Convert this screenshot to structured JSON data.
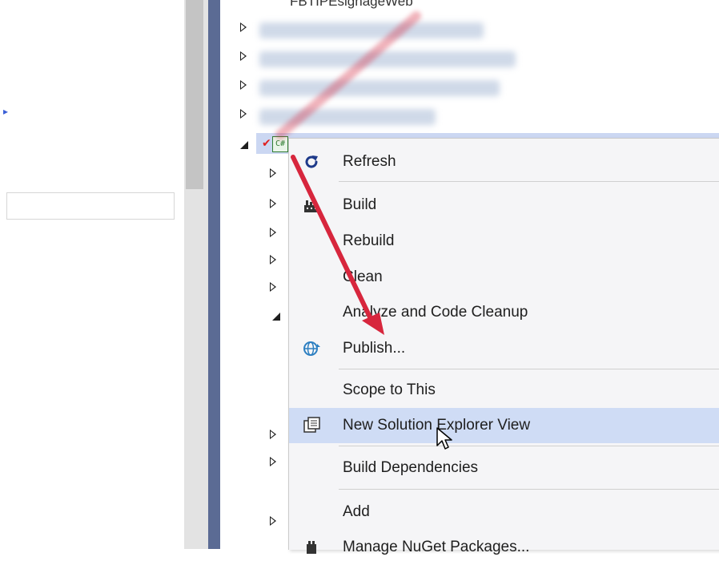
{
  "top_item_label": "FBTIPEsignageWeb",
  "project_icon_label": "C#",
  "context_menu": {
    "items": [
      {
        "label": "Refresh",
        "icon": "refresh-icon"
      },
      {
        "label": "Build",
        "icon": "build-icon"
      },
      {
        "label": "Rebuild",
        "icon": ""
      },
      {
        "label": "Clean",
        "icon": ""
      },
      {
        "label": "Analyze and Code Cleanup",
        "icon": ""
      },
      {
        "label": "Publish...",
        "icon": "publish-globe-icon"
      },
      {
        "label": "Scope to This",
        "icon": ""
      },
      {
        "label": "New Solution Explorer View",
        "icon": "new-view-icon"
      },
      {
        "label": "Build Dependencies",
        "icon": ""
      },
      {
        "label": "Add",
        "icon": ""
      },
      {
        "label": "Manage NuGet Packages...",
        "icon": "nuget-icon"
      }
    ]
  },
  "colors": {
    "accent_arrow": "#d7263d",
    "selection": "#cfdcf5",
    "divider": "#5b6b94"
  }
}
